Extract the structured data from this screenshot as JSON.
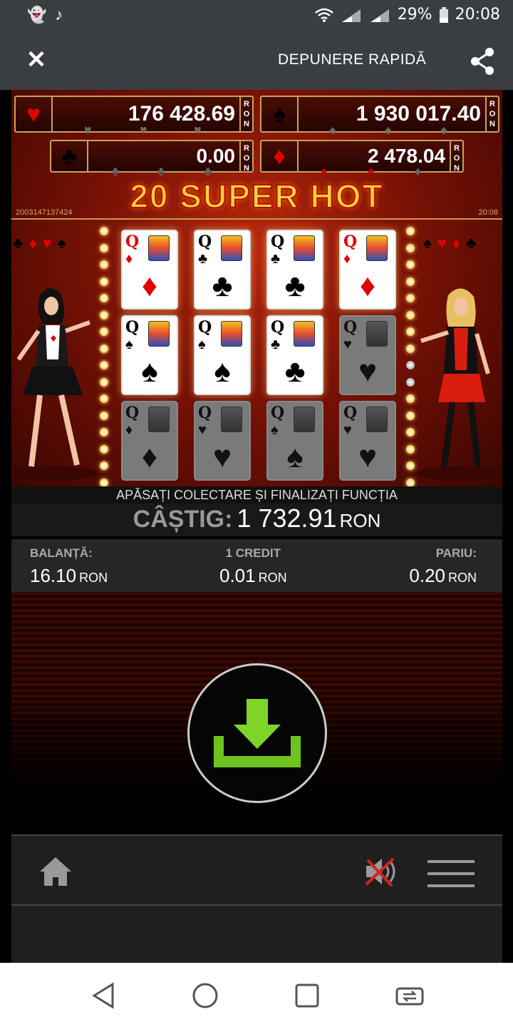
{
  "status_bar": {
    "battery": "29%",
    "time": "20:08",
    "icons": [
      "snapchat-icon",
      "tiktok-icon",
      "wifi-icon",
      "signal-icon",
      "signal-icon",
      "battery-icon"
    ]
  },
  "header": {
    "title": "DEPUNERE RAPIDĂ",
    "close_icon": "close-icon",
    "share_icon": "share-icon"
  },
  "jackpots": [
    {
      "suit": "♥",
      "suit_name": "hearts",
      "color": "#e00000",
      "value": "176 428.69",
      "unit": "RON"
    },
    {
      "suit": "♠",
      "suit_name": "spades",
      "color": "#000000",
      "value": "1 930 017.40",
      "unit": "RON"
    },
    {
      "suit": "♣",
      "suit_name": "clubs",
      "color": "#000000",
      "value": "0.00",
      "unit": "RON"
    },
    {
      "suit": "♦",
      "suit_name": "diamonds",
      "color": "#e00000",
      "value": "2 478.04",
      "unit": "RON"
    }
  ],
  "game": {
    "title": "20 SUPER HOT",
    "id": "2003147137424",
    "time": "20:08",
    "side_suits_left": [
      "♣",
      "♦",
      "♥",
      "♠"
    ],
    "side_suits_right": [
      "♠",
      "♥",
      "♦",
      "♣"
    ],
    "cards": [
      [
        {
          "rank": "Q",
          "suit": "♦",
          "red": true,
          "dim": false
        },
        {
          "rank": "Q",
          "suit": "♣",
          "red": false,
          "dim": false
        },
        {
          "rank": "Q",
          "suit": "♣",
          "red": false,
          "dim": false
        },
        {
          "rank": "Q",
          "suit": "♦",
          "red": true,
          "dim": false
        }
      ],
      [
        {
          "rank": "Q",
          "suit": "♠",
          "red": false,
          "dim": false
        },
        {
          "rank": "Q",
          "suit": "♠",
          "red": false,
          "dim": false
        },
        {
          "rank": "Q",
          "suit": "♣",
          "red": false,
          "dim": false
        },
        {
          "rank": "Q",
          "suit": "♥",
          "red": true,
          "dim": true
        }
      ],
      [
        {
          "rank": "Q",
          "suit": "♦",
          "red": true,
          "dim": true
        },
        {
          "rank": "Q",
          "suit": "♥",
          "red": true,
          "dim": true
        },
        {
          "rank": "Q",
          "suit": "♠",
          "red": false,
          "dim": true
        },
        {
          "rank": "Q",
          "suit": "♥",
          "red": true,
          "dim": true
        }
      ]
    ]
  },
  "message": "APĂSAȚI COLECTARE ȘI FINALIZAȚI FUNCȚIA",
  "win": {
    "label": "CÂȘTIG:",
    "value": "1 732.91",
    "unit": "RON"
  },
  "info": {
    "balance": {
      "label": "BALANȚĂ:",
      "value": "16.10",
      "unit": "RON"
    },
    "credit": {
      "label": "1 CREDIT",
      "value": "0.01",
      "unit": "RON"
    },
    "bet": {
      "label": "PARIU:",
      "value": "0.20",
      "unit": "RON"
    }
  },
  "controls": {
    "collect_icon": "download-icon",
    "collect_color": "#6ec31e",
    "home_icon": "home-icon",
    "sound_icon": "sound-muted-icon",
    "menu_icon": "hamburger-menu-icon"
  },
  "nav": [
    "back-icon",
    "home-circle-icon",
    "recents-icon",
    "switch-app-icon"
  ]
}
